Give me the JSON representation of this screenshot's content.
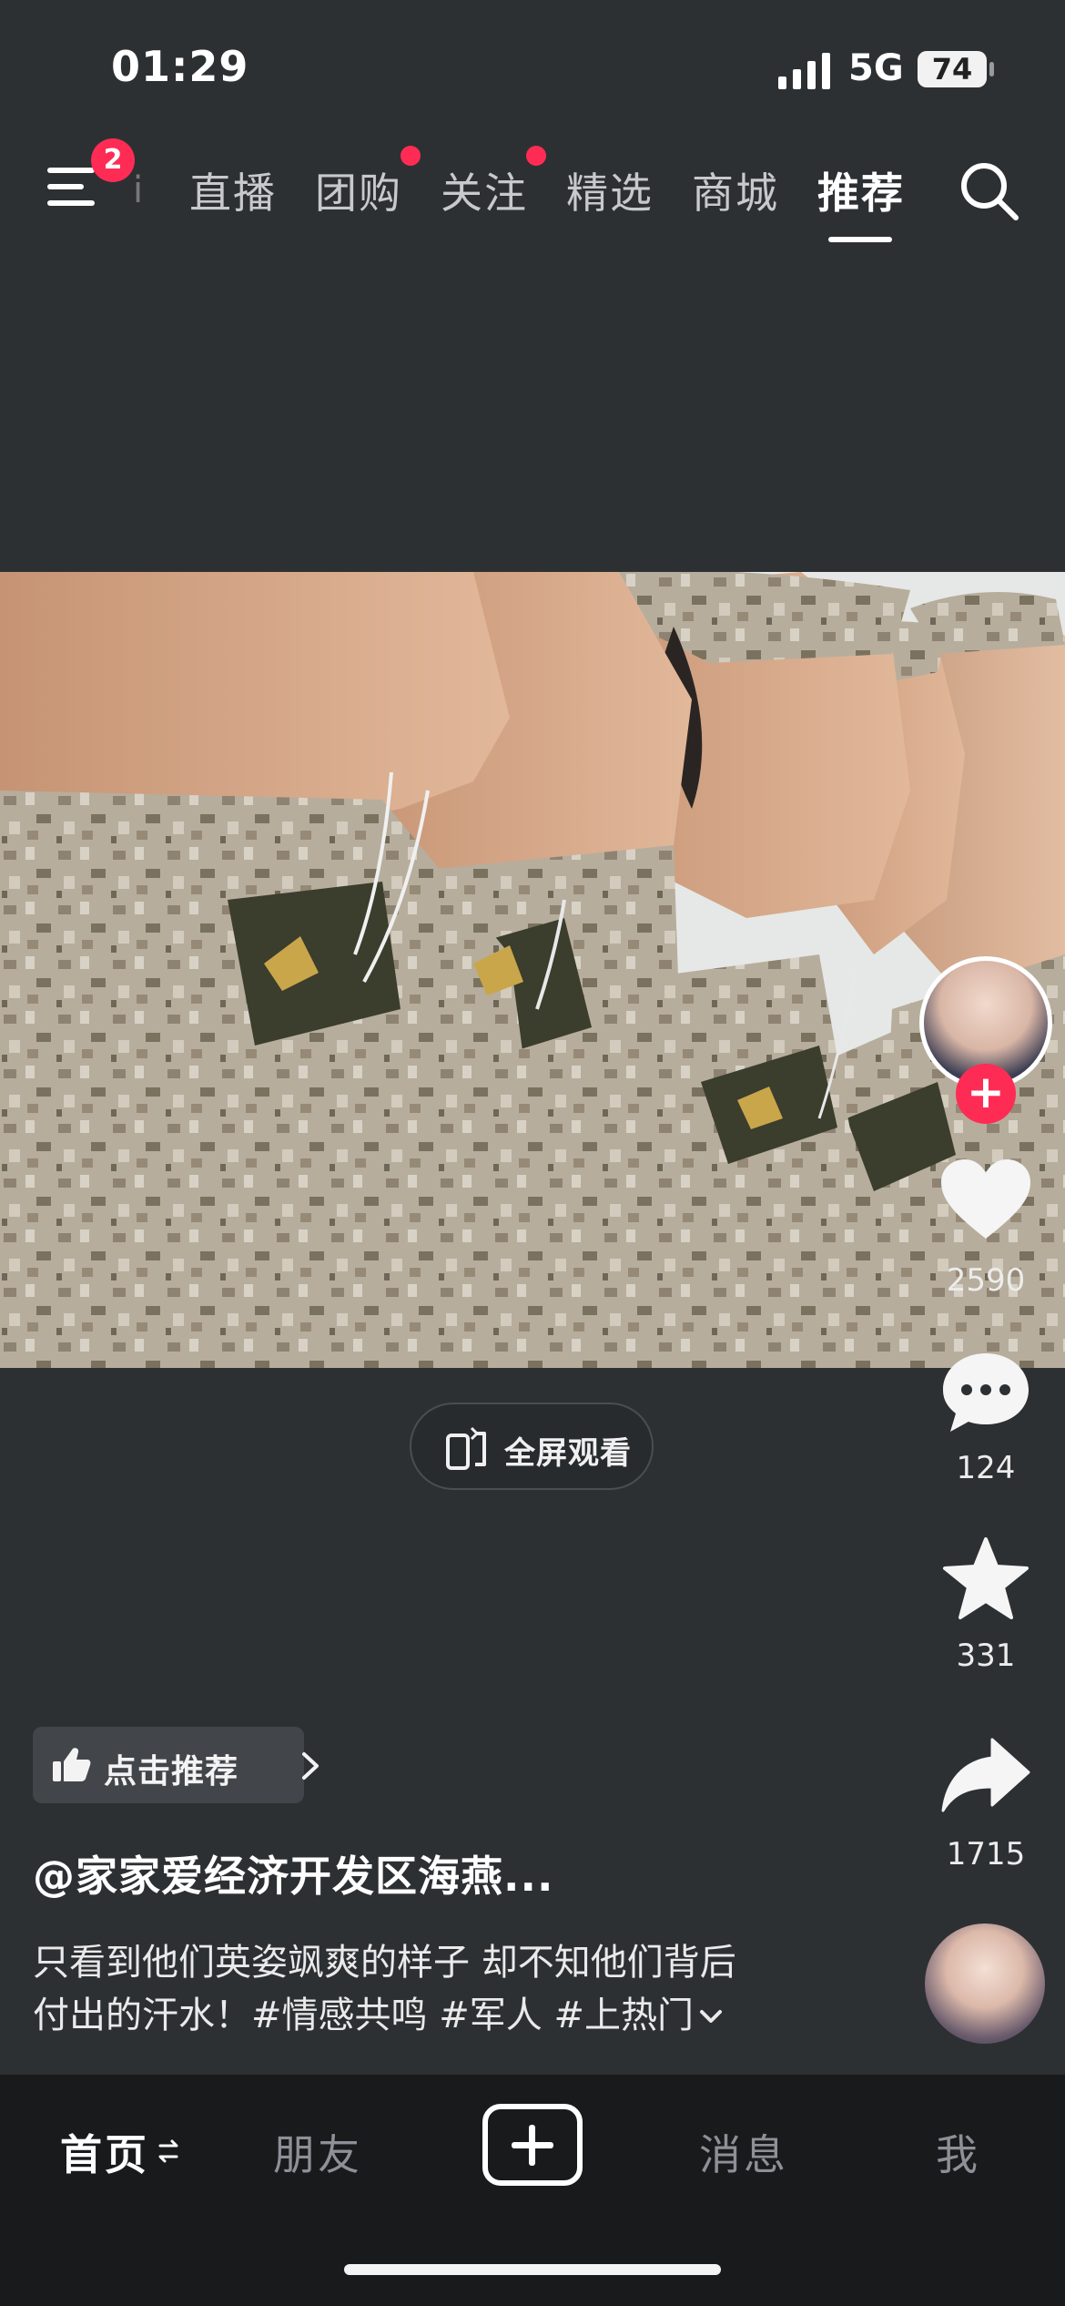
{
  "status_bar": {
    "time": "01:29",
    "network": "5G",
    "battery": "74"
  },
  "top_nav": {
    "menu_badge": "2",
    "tabs": [
      {
        "label": "直播",
        "dot": false
      },
      {
        "label": "团购",
        "dot": true
      },
      {
        "label": "关注",
        "dot": true
      },
      {
        "label": "精选",
        "dot": false
      },
      {
        "label": "商城",
        "dot": false
      },
      {
        "label": "推荐",
        "dot": false,
        "active": true
      }
    ],
    "faded_fragment": "i"
  },
  "player": {
    "fullscreen_label": "全屏观看"
  },
  "actions": {
    "likes": "2590",
    "comments": "124",
    "favorites": "331",
    "shares": "1715"
  },
  "post": {
    "recommend_label": "点击推荐",
    "author": "@家家爱经济开发区海燕...",
    "caption_line1": "只看到他们英姿飒爽的样子 却不知他们背后",
    "caption_line2": "付出的汗水！#情感共鸣 #军人 #上热门"
  },
  "bottom_nav": {
    "home": "首页",
    "friends": "朋友",
    "messages": "消息",
    "me": "我"
  },
  "icons": {
    "menu": "menu-icon",
    "search": "search-icon",
    "like": "heart-icon",
    "comment": "comment-icon",
    "favorite": "star-icon",
    "share": "share-icon",
    "fullscreen": "rotate-screen-icon",
    "recommend": "thumbs-up-icon",
    "create": "plus-icon"
  },
  "colors": {
    "background": "#2d3033",
    "accent": "#fe2c55",
    "bottom_bar": "#181a1c"
  }
}
